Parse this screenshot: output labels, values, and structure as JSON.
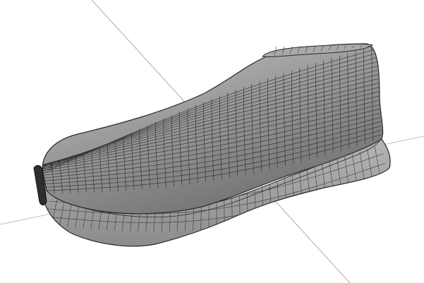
{
  "viewport": {
    "background": "#ffffff",
    "axis_colors": {
      "red_axis": "#c9a0ad",
      "green_axis": "#b8c7a4"
    },
    "model": {
      "name": "shoe-last",
      "surface_color": "#9a9a9a",
      "surface_shadow": "#6f6f6f",
      "surface_highlight": "#c8c8c8",
      "sole_color": "#a8a8a8",
      "edge_color": "#2a2a2a"
    }
  }
}
